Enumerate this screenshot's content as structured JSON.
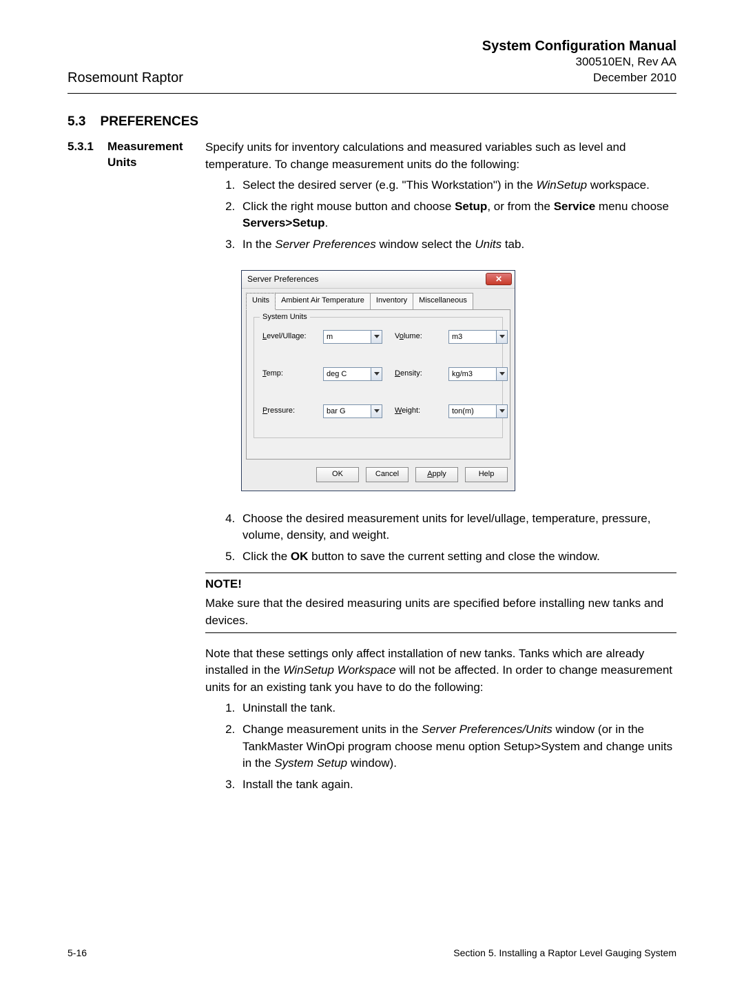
{
  "header": {
    "productName": "Rosemount Raptor",
    "manualTitle": "System Configuration Manual",
    "docId": "300510EN, Rev AA",
    "date": "December 2010"
  },
  "section": {
    "number": "5.3",
    "title": "PREFERENCES",
    "sub": {
      "number": "5.3.1",
      "title": "Measurement Units"
    }
  },
  "text": {
    "intro": "Specify units for inventory calculations and measured variables such as level and temperature. To change measurement units do the following:",
    "step1a": "Select the desired server (e.g. \"This Workstation\") in the ",
    "step1b": "WinSetup",
    "step1c": " workspace.",
    "step2a": "Click the right mouse button and choose ",
    "step2b": "Setup",
    "step2c": ", or from the ",
    "step2d": "Service",
    "step2e": " menu choose ",
    "step2f": "Servers>Setup",
    "step2g": ".",
    "step3a": "In the ",
    "step3b": "Server Preferences",
    "step3c": " window select the ",
    "step3d": "Units",
    "step3e": " tab.",
    "step4": "Choose the desired measurement units for level/ullage, temperature, pressure, volume, density, and weight.",
    "step5a": "Click the ",
    "step5b": "OK",
    "step5c": " button to save the current setting and close the window.",
    "noteHead": "NOTE!",
    "noteBody": "Make sure that the desired measuring units are specified before installing new tanks and devices.",
    "para2a": "Note that these settings only affect installation of new tanks. Tanks which are already installed in the ",
    "para2b": "WinSetup Workspace",
    "para2c": " will not be affected. In order to change measurement units for an existing tank you have to do the following:",
    "b1": "Uninstall the tank.",
    "b2a": "Change measurement units in the ",
    "b2b": "Server Preferences/Units",
    "b2c": " window (or in the TankMaster WinOpi program choose menu option Setup>System and change units in the ",
    "b2d": "System Setup",
    "b2e": " window).",
    "b3": "Install the tank again."
  },
  "dialog": {
    "title": "Server Preferences",
    "closeGlyph": "✕",
    "tabs": [
      "Units",
      "Ambient Air Temperature",
      "Inventory",
      "Miscellaneous"
    ],
    "groupTitle": "System Units",
    "fields": {
      "level": {
        "labelPre": "L",
        "labelRest": "evel/Ullage:",
        "value": "m"
      },
      "volume": {
        "labelPre": "V",
        "labelU": "o",
        "labelRest": "lume:",
        "value": "m3"
      },
      "temp": {
        "labelU": "T",
        "labelRest": "emp:",
        "value": "deg C"
      },
      "density": {
        "labelU": "D",
        "labelRest": "ensity:",
        "value": "kg/m3"
      },
      "pressure": {
        "labelU": "P",
        "labelRest": "ressure:",
        "value": "bar G"
      },
      "weight": {
        "labelU": "W",
        "labelRest": "eight:",
        "value": "ton(m)"
      }
    },
    "buttons": {
      "ok": "OK",
      "cancel": "Cancel",
      "applyU": "A",
      "applyRest": "pply",
      "help": "Help"
    }
  },
  "footer": {
    "pageNum": "5-16",
    "sectionTitle": "Section 5. Installing a Raptor Level Gauging System"
  }
}
